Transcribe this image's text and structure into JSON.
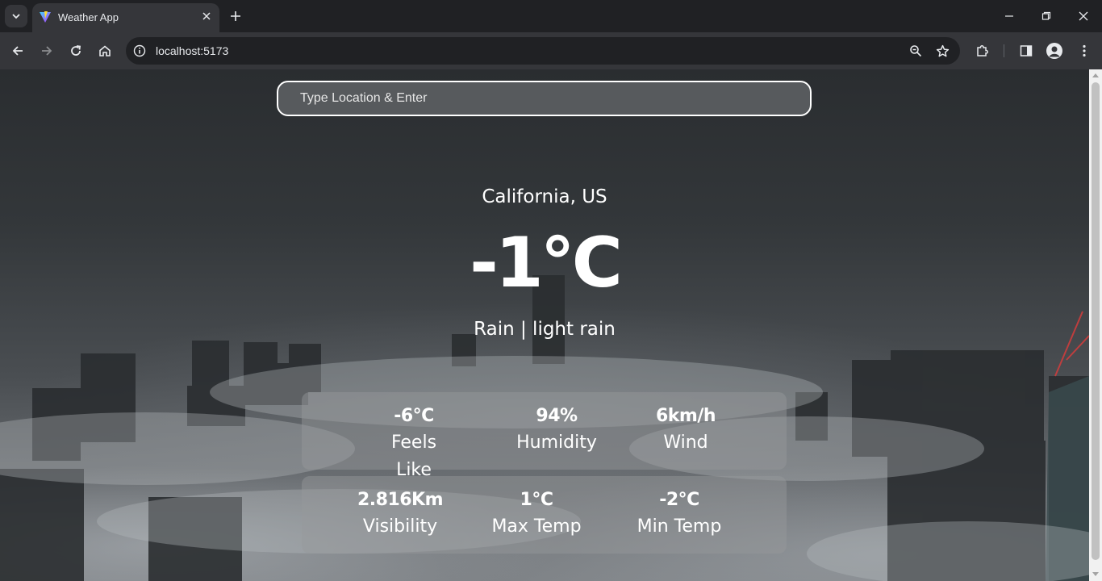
{
  "browser": {
    "tab_title": "Weather App",
    "url": "localhost:5173"
  },
  "app": {
    "search_placeholder": "Type Location & Enter",
    "location": "California, US",
    "temperature": "-1°C",
    "condition": "Rain | light rain",
    "stats_row1": [
      {
        "value": "-6°C",
        "label": "Feels Like"
      },
      {
        "value": "94%",
        "label": "Humidity"
      },
      {
        "value": "6km/h",
        "label": "Wind"
      }
    ],
    "stats_row2": [
      {
        "value": "2.816Km",
        "label": "Visibility"
      },
      {
        "value": "1°C",
        "label": "Max Temp"
      },
      {
        "value": "-2°C",
        "label": "Min Temp"
      }
    ]
  },
  "icons": {
    "tab_list": "chevron-down-icon",
    "favicon": "vite-logo-icon",
    "tab_close": "close-icon",
    "new_tab": "plus-icon",
    "minimize": "minimize-icon",
    "restore": "restore-icon",
    "close_window": "close-icon",
    "back": "arrow-left-icon",
    "forward": "arrow-right-icon",
    "reload": "reload-icon",
    "home": "home-icon",
    "site_info": "info-icon",
    "zoom": "zoom-icon",
    "bookmark": "star-icon",
    "extensions": "puzzle-icon",
    "side_panel": "side-panel-icon",
    "profile": "profile-icon",
    "menu": "kebab-menu-icon"
  }
}
